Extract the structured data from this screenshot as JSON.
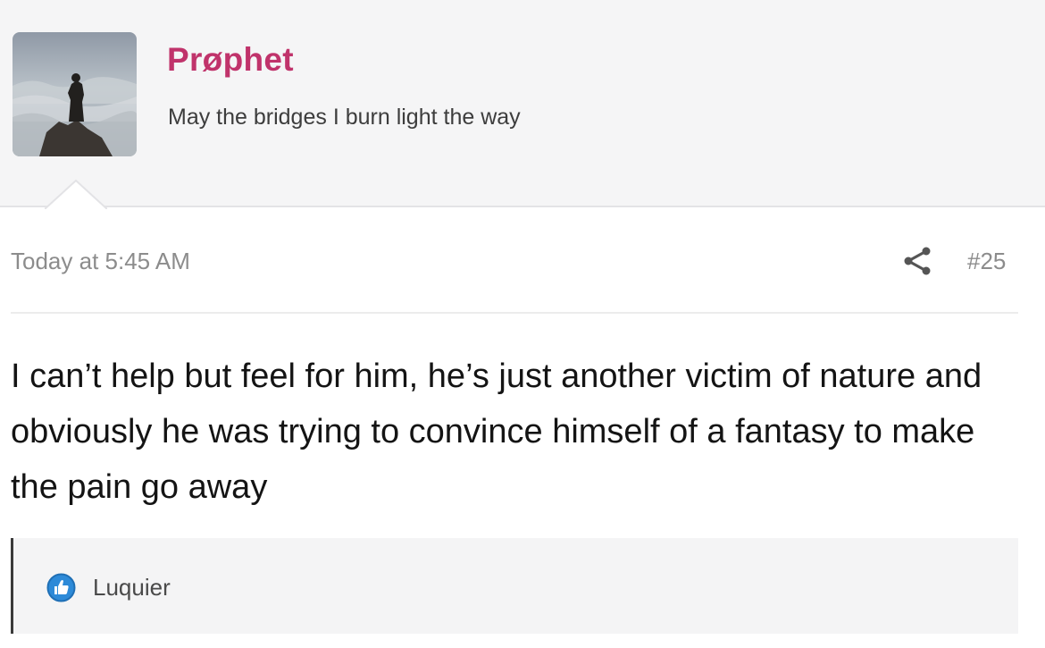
{
  "user": {
    "name": "Prøphet",
    "title": "May the bridges I burn light the way"
  },
  "post": {
    "date": "Today at 5:45 AM",
    "number": "#25",
    "message": "I can’t help but feel for him, he’s just another victim of nature and obviously he was trying to convince himself of a fantasy to make the pain go away"
  },
  "likes": {
    "names": "Luquier"
  },
  "colors": {
    "username": "#c0336b",
    "like_icon": "#2d8ad8"
  },
  "icons": {
    "share": "share-icon",
    "like": "thumbs-up-icon"
  }
}
